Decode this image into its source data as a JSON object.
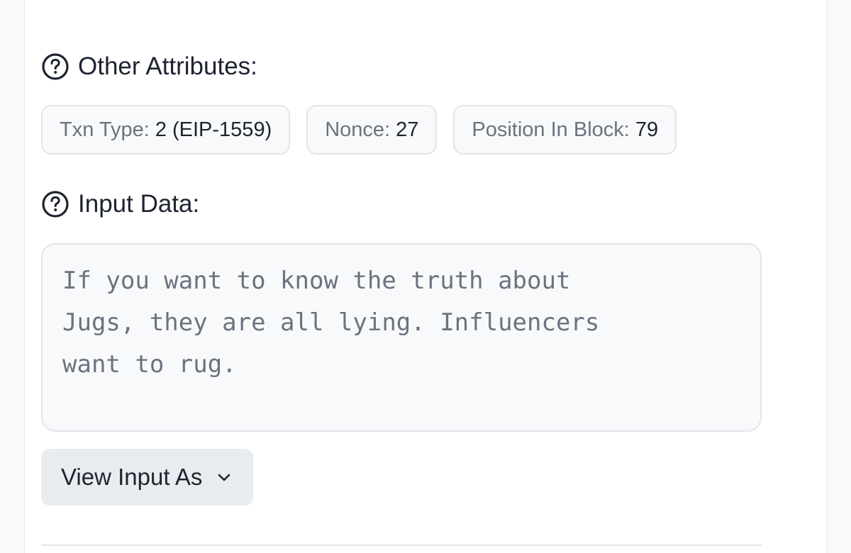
{
  "other_attributes": {
    "heading": "Other Attributes:",
    "help_icon": "question-circle-icon",
    "badges": [
      {
        "label": "Txn Type:",
        "value": "2 (EIP-1559)"
      },
      {
        "label": "Nonce:",
        "value": "27"
      },
      {
        "label": "Position In Block:",
        "value": "79"
      }
    ]
  },
  "input_data": {
    "heading": "Input Data:",
    "help_icon": "question-circle-icon",
    "text": "If you want to know the truth about\nJugs, they are all lying. Influencers\nwant to rug.",
    "view_button_label": "View Input As",
    "view_button_icon": "chevron-down-icon"
  },
  "colors": {
    "text_primary": "#1e2330",
    "text_muted": "#6c727f",
    "badge_bg": "#f8f9fa",
    "badge_border": "#e3e5e9",
    "button_bg": "#e9ecef"
  }
}
